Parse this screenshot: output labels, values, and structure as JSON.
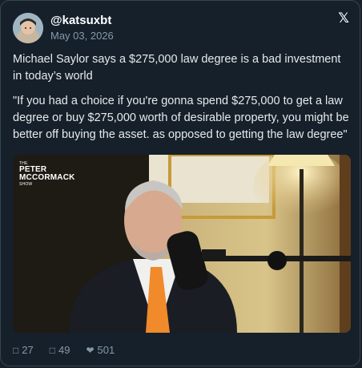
{
  "author": {
    "handle": "@katsuxbt",
    "date": "May 03, 2026",
    "avatar_icon": "avatar-photo"
  },
  "platform_icon": "x-logo",
  "platform_glyph": "𝕏",
  "tweet": {
    "paragraph_1": "Michael Saylor says a $275,000 law degree is a bad investment in today’s world",
    "paragraph_2": "\"If you had a choice if you're gonna spend $275,000 to get a law degree or buy $275,000 worth of desirable property, you might be better off buying the asset. as opposed to getting the law degree\""
  },
  "media": {
    "logo_small": "THE",
    "logo_line1": "PETER",
    "logo_line2": "MCCORMACK",
    "logo_small2": "SHOW"
  },
  "actions": {
    "reply_icon": "reply-icon",
    "reply_count": "27",
    "retweet_icon": "retweet-icon",
    "retweet_count": "49",
    "like_icon": "heart-icon",
    "like_count": "501"
  },
  "colors": {
    "background": "#15202b",
    "border": "#38444d",
    "muted": "#8899a6",
    "text": "#e7e9ea"
  }
}
